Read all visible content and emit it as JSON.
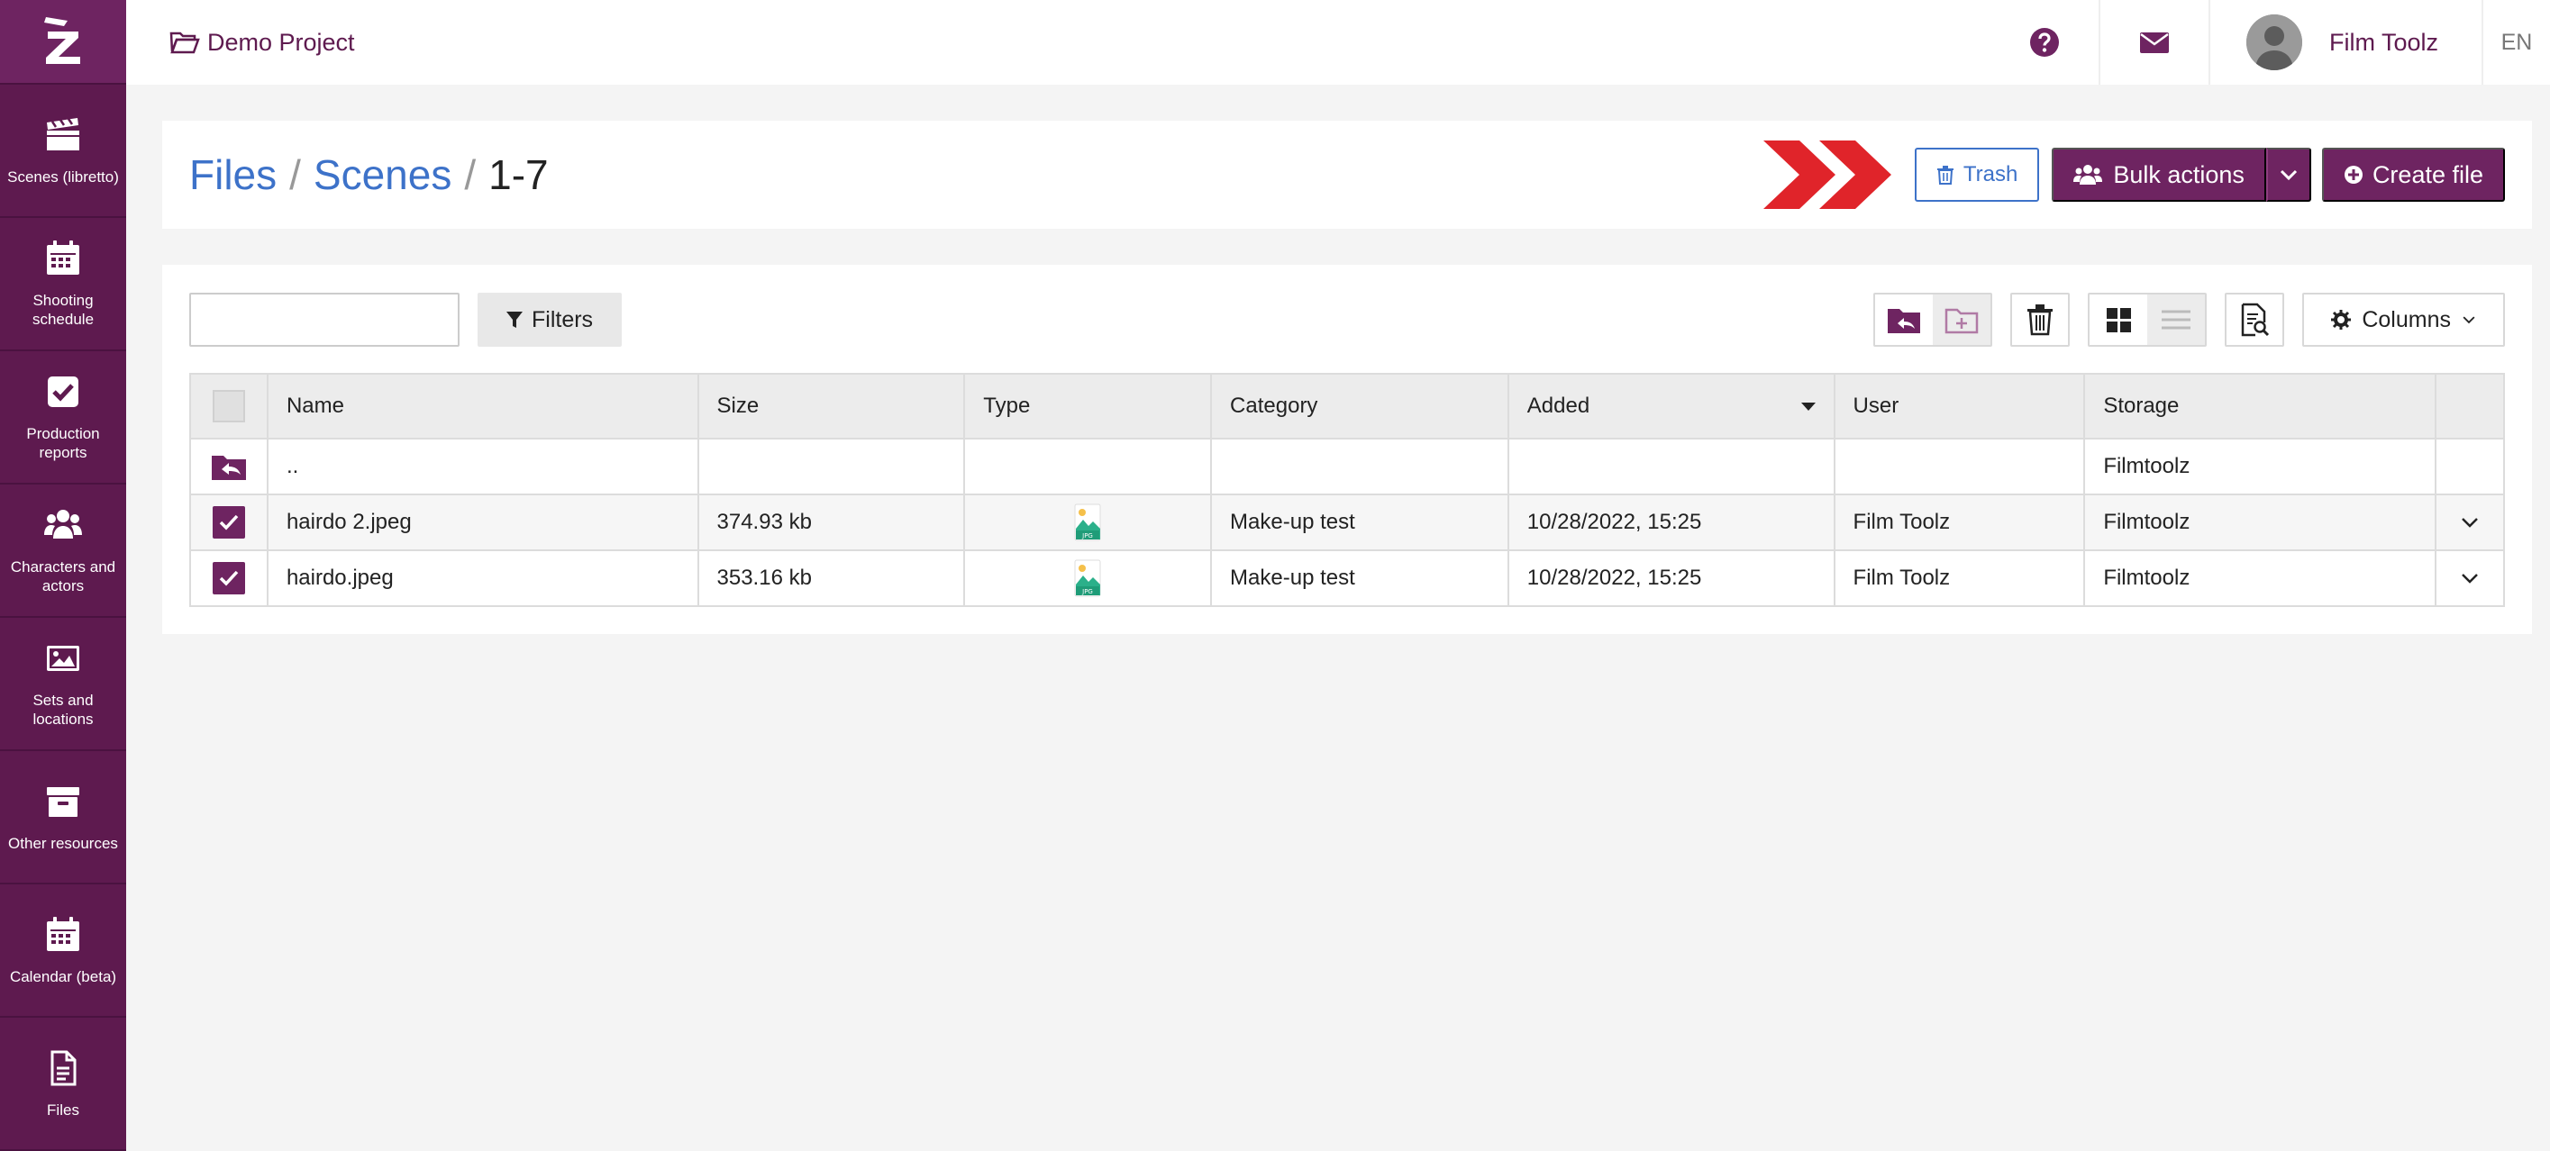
{
  "sidebar": {
    "items": [
      {
        "label": "Scenes (libretto)",
        "icon": "clapperboard-icon"
      },
      {
        "label": "Shooting schedule",
        "icon": "calendar-icon"
      },
      {
        "label": "Production reports",
        "icon": "checkbox-icon"
      },
      {
        "label": "Characters and actors",
        "icon": "users-icon"
      },
      {
        "label": "Sets and locations",
        "icon": "image-icon"
      },
      {
        "label": "Other resources",
        "icon": "archive-icon"
      },
      {
        "label": "Calendar (beta)",
        "icon": "calendar-icon"
      },
      {
        "label": "Files",
        "icon": "file-icon"
      }
    ]
  },
  "topbar": {
    "project": "Demo Project",
    "user_name": "Film Toolz",
    "language": "EN"
  },
  "header": {
    "breadcrumb": [
      "Files",
      "Scenes",
      "1-7"
    ],
    "trash_label": "Trash",
    "bulk_label": "Bulk actions",
    "create_label": "Create file"
  },
  "toolbar": {
    "search_placeholder": "",
    "filters_label": "Filters",
    "columns_label": "Columns"
  },
  "table": {
    "columns": [
      "Name",
      "Size",
      "Type",
      "Category",
      "Added",
      "User",
      "Storage"
    ],
    "parent_row": {
      "name": "..",
      "storage": "Filmtoolz"
    },
    "rows": [
      {
        "name": "hairdo 2.jpeg",
        "size": "374.93 kb",
        "type": "jpg",
        "category": "Make-up test",
        "added": "10/28/2022, 15:25",
        "user": "Film Toolz",
        "storage": "Filmtoolz",
        "checked": true
      },
      {
        "name": "hairdo.jpeg",
        "size": "353.16 kb",
        "type": "jpg",
        "category": "Make-up test",
        "added": "10/28/2022, 15:25",
        "user": "Film Toolz",
        "storage": "Filmtoolz",
        "checked": true
      }
    ]
  },
  "colors": {
    "sidebar": "#5e1a4f",
    "primary": "#6e2461",
    "link": "#3d72c9",
    "accent_arrow": "#e0242a"
  }
}
